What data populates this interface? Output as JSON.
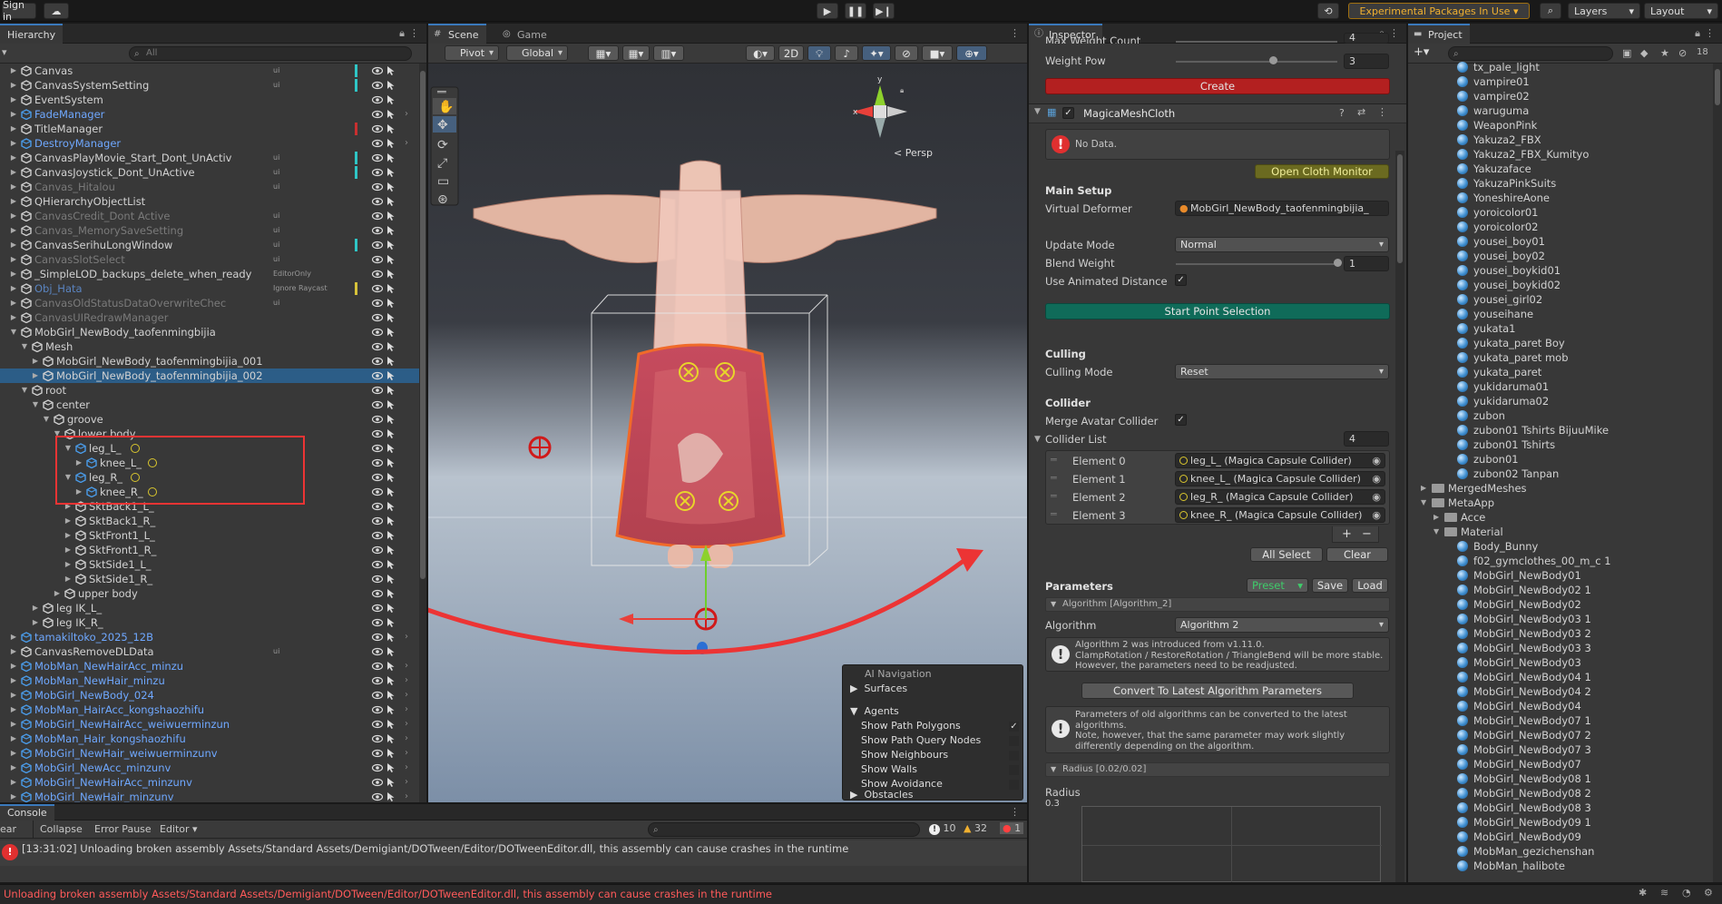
{
  "topbar": {
    "sign_in": "Sign in",
    "experimental": "Experimental Packages In Use",
    "layers": "Layers",
    "layout": "Layout"
  },
  "hierarchy": {
    "tab": "Hierarchy",
    "search_placeholder": "All",
    "rows": [
      {
        "name": "Canvas",
        "indent": 0,
        "color": "#d2d2d2",
        "tag": "ui",
        "bar": "#2fc6c6"
      },
      {
        "name": "CanvasSystemSetting",
        "indent": 0,
        "color": "#d2d2d2",
        "tag": "ui",
        "bar": "#2fc6c6"
      },
      {
        "name": "EventSystem",
        "indent": 0,
        "color": "#d2d2d2",
        "tag": "",
        "bar": ""
      },
      {
        "name": "FadeManager",
        "indent": 0,
        "color": "#6fa8ff",
        "tag": "",
        "bar": "",
        "prefab": true
      },
      {
        "name": "TitleManager",
        "indent": 0,
        "color": "#d2d2d2",
        "tag": "",
        "bar": "#c83030"
      },
      {
        "name": "DestroyManager",
        "indent": 0,
        "color": "#6fa8ff",
        "tag": "",
        "bar": "",
        "prefab": true
      },
      {
        "name": "CanvasPlayMovie_Start_Dont_UnActiv",
        "indent": 0,
        "color": "#d2d2d2",
        "tag": "ui",
        "bar": "#2fc6c6"
      },
      {
        "name": "CanvasJoystick_Dont_UnActive",
        "indent": 0,
        "color": "#d2d2d2",
        "tag": "ui",
        "bar": "#2fc6c6"
      },
      {
        "name": "Canvas_Hitalou",
        "indent": 0,
        "color": "#7a7a7a",
        "tag": "ui",
        "bar": ""
      },
      {
        "name": "QHierarchyObjectList",
        "indent": 0,
        "color": "#d2d2d2",
        "tag": "",
        "bar": ""
      },
      {
        "name": "CanvasCredit_Dont Active",
        "indent": 0,
        "color": "#7a7a7a",
        "tag": "ui",
        "bar": ""
      },
      {
        "name": "Canvas_MemorySaveSetting",
        "indent": 0,
        "color": "#7a7a7a",
        "tag": "ui",
        "bar": ""
      },
      {
        "name": "CanvasSerihuLongWindow",
        "indent": 0,
        "color": "#d2d2d2",
        "tag": "ui",
        "bar": "#2fc6c6"
      },
      {
        "name": "CanvasSlotSelect",
        "indent": 0,
        "color": "#7a7a7a",
        "tag": "ui",
        "bar": ""
      },
      {
        "name": "_SimpleLOD_backups_delete_when_ready",
        "indent": 0,
        "color": "#d2d2d2",
        "tag": "EditorOnly",
        "bar": ""
      },
      {
        "name": "Obj_Hata",
        "indent": 0,
        "color": "#5a84c0",
        "tag": "Ignore Raycast",
        "bar": "#d6c23a"
      },
      {
        "name": "CanvasOldStatusDataOverwriteChec",
        "indent": 0,
        "color": "#7a7a7a",
        "tag": "ui",
        "bar": ""
      },
      {
        "name": "CanvasUIRedrawManager",
        "indent": 0,
        "color": "#7a7a7a",
        "tag": "",
        "bar": ""
      },
      {
        "name": "MobGirl_NewBody_taofenmingbijia",
        "indent": 0,
        "color": "#d2d2d2",
        "tag": "",
        "bar": "",
        "open": true
      },
      {
        "name": "Mesh",
        "indent": 1,
        "color": "#d2d2d2",
        "tag": "",
        "bar": "",
        "open": true
      },
      {
        "name": "MobGirl_NewBody_taofenmingbijia_001",
        "indent": 2,
        "color": "#d2d2d2",
        "tag": "",
        "bar": ""
      },
      {
        "name": "MobGirl_NewBody_taofenmingbijia_002",
        "indent": 2,
        "color": "#d2d2d2",
        "tag": "",
        "bar": "",
        "selected": true
      },
      {
        "name": "root",
        "indent": 1,
        "color": "#d2d2d2",
        "tag": "",
        "bar": "",
        "open": true
      },
      {
        "name": "center",
        "indent": 2,
        "color": "#d2d2d2",
        "tag": "",
        "bar": "",
        "open": true
      },
      {
        "name": "groove",
        "indent": 3,
        "color": "#d2d2d2",
        "tag": "",
        "bar": "",
        "open": true
      },
      {
        "name": "lower body",
        "indent": 4,
        "color": "#d2d2d2",
        "tag": "",
        "bar": "",
        "open": true
      },
      {
        "name": "leg_L_",
        "indent": 5,
        "color": "#d2d2d2",
        "tag": "",
        "bar": "",
        "open": true,
        "blue": true
      },
      {
        "name": "knee_L_",
        "indent": 6,
        "color": "#d2d2d2",
        "tag": "",
        "bar": "",
        "blue": true
      },
      {
        "name": "leg_R_",
        "indent": 5,
        "color": "#d2d2d2",
        "tag": "",
        "bar": "",
        "open": true,
        "blue": true
      },
      {
        "name": "knee_R_",
        "indent": 6,
        "color": "#d2d2d2",
        "tag": "",
        "bar": "",
        "blue": true
      },
      {
        "name": "SktBack1_L_",
        "indent": 5,
        "color": "#d2d2d2",
        "tag": "",
        "bar": ""
      },
      {
        "name": "SktBack1_R_",
        "indent": 5,
        "color": "#d2d2d2",
        "tag": "",
        "bar": ""
      },
      {
        "name": "SktFront1_L_",
        "indent": 5,
        "color": "#d2d2d2",
        "tag": "",
        "bar": ""
      },
      {
        "name": "SktFront1_R_",
        "indent": 5,
        "color": "#d2d2d2",
        "tag": "",
        "bar": ""
      },
      {
        "name": "SktSide1_L_",
        "indent": 5,
        "color": "#d2d2d2",
        "tag": "",
        "bar": ""
      },
      {
        "name": "SktSide1_R_",
        "indent": 5,
        "color": "#d2d2d2",
        "tag": "",
        "bar": ""
      },
      {
        "name": "upper body",
        "indent": 4,
        "color": "#d2d2d2",
        "tag": "",
        "bar": ""
      },
      {
        "name": "leg IK_L_",
        "indent": 2,
        "color": "#d2d2d2",
        "tag": "",
        "bar": ""
      },
      {
        "name": "leg IK_R_",
        "indent": 2,
        "color": "#d2d2d2",
        "tag": "",
        "bar": ""
      },
      {
        "name": "tamakiltoko_2025_12B",
        "indent": 0,
        "color": "#6fa8ff",
        "tag": "",
        "bar": "",
        "prefab": true
      },
      {
        "name": "CanvasRemoveDLData",
        "indent": 0,
        "color": "#d2d2d2",
        "tag": "ui",
        "bar": ""
      },
      {
        "name": "MobMan_NewHairAcc_minzu",
        "indent": 0,
        "color": "#6fa8ff",
        "tag": "",
        "bar": "",
        "prefab": true
      },
      {
        "name": "MobMan_NewHair_minzu",
        "indent": 0,
        "color": "#6fa8ff",
        "tag": "",
        "bar": "",
        "prefab": true
      },
      {
        "name": "MobGirl_NewBody_024",
        "indent": 0,
        "color": "#6fa8ff",
        "tag": "",
        "bar": "",
        "prefab": true
      },
      {
        "name": "MobMan_HairAcc_kongshaozhifu",
        "indent": 0,
        "color": "#6fa8ff",
        "tag": "",
        "bar": "",
        "prefab": true
      },
      {
        "name": "MobGirl_NewHairAcc_weiwuerminzun",
        "indent": 0,
        "color": "#6fa8ff",
        "tag": "",
        "bar": "",
        "prefab": true
      },
      {
        "name": "MobMan_Hair_kongshaozhifu",
        "indent": 0,
        "color": "#6fa8ff",
        "tag": "",
        "bar": "",
        "prefab": true
      },
      {
        "name": "MobGirl_NewHair_weiwuerminzunv",
        "indent": 0,
        "color": "#6fa8ff",
        "tag": "",
        "bar": "",
        "prefab": true
      },
      {
        "name": "MobGirl_NewAcc_minzunv",
        "indent": 0,
        "color": "#6fa8ff",
        "tag": "",
        "bar": "",
        "prefab": true
      },
      {
        "name": "MobGirl_NewHairAcc_minzunv",
        "indent": 0,
        "color": "#6fa8ff",
        "tag": "",
        "bar": "",
        "prefab": true
      },
      {
        "name": "MobGirl_NewHair_minzunv",
        "indent": 0,
        "color": "#6fa8ff",
        "tag": "",
        "bar": "",
        "prefab": true
      }
    ]
  },
  "scene": {
    "tab_scene": "Scene",
    "tab_game": "Game",
    "pivot": "Pivot",
    "global": "Global",
    "mode2d": "2D",
    "persp": "Persp",
    "nav_overlay": {
      "title": "AI Navigation",
      "surfaces": "Surfaces",
      "agents": "Agents",
      "items": [
        "Show Path Polygons",
        "Show Path Query Nodes",
        "Show Neighbours",
        "Show Walls",
        "Show Avoidance"
      ],
      "obstacles": "Obstacles"
    }
  },
  "inspector": {
    "tab": "Inspector",
    "max_weight_count_label": "Max Weight Count",
    "max_weight_count_value": "4",
    "weight_pow_label": "Weight Pow",
    "weight_pow_value": "3",
    "weight_pow_level": 0.6,
    "create_button": "Create",
    "component_title": "MagicaMeshCloth",
    "no_data": "No Data.",
    "open_cloth_monitor": "Open Cloth Monitor",
    "main_setup": "Main Setup",
    "virtual_deformer_label": "Virtual Deformer",
    "virtual_deformer_value": "MobGirl_NewBody_taofenmingbijia_",
    "update_mode_label": "Update Mode",
    "update_mode_value": "Normal",
    "blend_weight_label": "Blend Weight",
    "blend_weight_value": "1",
    "blend_weight_level": 1.0,
    "use_animated_distance_label": "Use Animated Distance",
    "start_point_selection": "Start Point Selection",
    "culling": "Culling",
    "culling_mode_label": "Culling Mode",
    "culling_mode_value": "Reset",
    "collider": "Collider",
    "merge_avatar_collider_label": "Merge Avatar Collider",
    "collider_list_label": "Collider List",
    "collider_list_count": "4",
    "elements": [
      {
        "label": "Element 0",
        "value": "leg_L_ (Magica Capsule Collider)"
      },
      {
        "label": "Element 1",
        "value": "knee_L_ (Magica Capsule Collider)"
      },
      {
        "label": "Element 2",
        "value": "leg_R_ (Magica Capsule Collider)"
      },
      {
        "label": "Element 3",
        "value": "knee_R_ (Magica Capsule Collider)"
      }
    ],
    "plus": "+",
    "minus": "−",
    "all_select": "All Select",
    "clear": "Clear",
    "parameters": "Parameters",
    "preset": "Preset",
    "save": "Save",
    "load": "Load",
    "algorithm_header": "Algorithm [Algorithm_2]",
    "algorithm_label": "Algorithm",
    "algorithm_value": "Algorithm 2",
    "algorithm_help": "Algorithm 2 was introduced from v1.11.0.\nClampRotation / RestoreRotation / TriangleBend will be more stable.\nHowever, the parameters need to be readjusted.",
    "convert_button": "Convert To Latest Algorithm Parameters",
    "convert_help": "Parameters of old algorithms can be converted to the latest algorithms.\nNote, however, that the same parameter may work slightly differently depending on the algorithm.",
    "radius_header": "Radius [0.02/0.02]",
    "radius_label": "Radius",
    "radius_value": "0.3"
  },
  "project": {
    "tab": "Project",
    "items": [
      {
        "name": "tx_pale_light",
        "type": "ball",
        "indent": 2
      },
      {
        "name": "vampire01",
        "type": "ball",
        "indent": 2
      },
      {
        "name": "vampire02",
        "type": "ball",
        "indent": 2
      },
      {
        "name": "waruguma",
        "type": "ball",
        "indent": 2
      },
      {
        "name": "WeaponPink",
        "type": "ball",
        "indent": 2
      },
      {
        "name": "Yakuza2_FBX",
        "type": "ball",
        "indent": 2
      },
      {
        "name": "Yakuza2_FBX_Kumityo",
        "type": "ball",
        "indent": 2
      },
      {
        "name": "Yakuzaface",
        "type": "ball",
        "indent": 2
      },
      {
        "name": "YakuzaPinkSuits",
        "type": "ball",
        "indent": 2
      },
      {
        "name": "YoneshireAone",
        "type": "ball",
        "indent": 2
      },
      {
        "name": "yoroicolor01",
        "type": "ball",
        "indent": 2
      },
      {
        "name": "yoroicolor02",
        "type": "ball",
        "indent": 2
      },
      {
        "name": "yousei_boy01",
        "type": "ball",
        "indent": 2
      },
      {
        "name": "yousei_boy02",
        "type": "ball",
        "indent": 2
      },
      {
        "name": "yousei_boykid01",
        "type": "ball",
        "indent": 2
      },
      {
        "name": "yousei_boykid02",
        "type": "ball",
        "indent": 2
      },
      {
        "name": "yousei_girl02",
        "type": "ball",
        "indent": 2
      },
      {
        "name": "youseihane",
        "type": "ball",
        "indent": 2
      },
      {
        "name": "yukata1",
        "type": "ball",
        "indent": 2
      },
      {
        "name": "yukata_paret Boy",
        "type": "ball",
        "indent": 2
      },
      {
        "name": "yukata_paret mob",
        "type": "ball",
        "indent": 2
      },
      {
        "name": "yukata_paret",
        "type": "ball",
        "indent": 2
      },
      {
        "name": "yukidaruma01",
        "type": "ball",
        "indent": 2
      },
      {
        "name": "yukidaruma02",
        "type": "ball",
        "indent": 2
      },
      {
        "name": "zubon",
        "type": "ball",
        "indent": 2
      },
      {
        "name": "zubon01 Tshirts BijuuMike",
        "type": "ball",
        "indent": 2
      },
      {
        "name": "zubon01 Tshirts",
        "type": "ball",
        "indent": 2
      },
      {
        "name": "zubon01",
        "type": "ball",
        "indent": 2
      },
      {
        "name": "zubon02 Tanpan",
        "type": "ball",
        "indent": 2
      },
      {
        "name": "MergedMeshes",
        "type": "folder",
        "indent": 0,
        "arrow": "▶"
      },
      {
        "name": "MetaApp",
        "type": "folder",
        "indent": 0,
        "arrow": "▼"
      },
      {
        "name": "Acce",
        "type": "folder",
        "indent": 1,
        "arrow": "▶"
      },
      {
        "name": "Material",
        "type": "folder",
        "indent": 1,
        "arrow": "▼"
      },
      {
        "name": "Body_Bunny",
        "type": "ball",
        "indent": 2
      },
      {
        "name": "f02_gymclothes_00_m_c 1",
        "type": "ball",
        "indent": 2
      },
      {
        "name": "MobGirl_NewBody01",
        "type": "ball",
        "indent": 2
      },
      {
        "name": "MobGirl_NewBody02 1",
        "type": "ball",
        "indent": 2
      },
      {
        "name": "MobGirl_NewBody02",
        "type": "ball",
        "indent": 2
      },
      {
        "name": "MobGirl_NewBody03 1",
        "type": "ball",
        "indent": 2
      },
      {
        "name": "MobGirl_NewBody03 2",
        "type": "ball",
        "indent": 2
      },
      {
        "name": "MobGirl_NewBody03 3",
        "type": "ball",
        "indent": 2
      },
      {
        "name": "MobGirl_NewBody03",
        "type": "ball",
        "indent": 2
      },
      {
        "name": "MobGirl_NewBody04 1",
        "type": "ball",
        "indent": 2
      },
      {
        "name": "MobGirl_NewBody04 2",
        "type": "ball",
        "indent": 2
      },
      {
        "name": "MobGirl_NewBody04",
        "type": "ball",
        "indent": 2
      },
      {
        "name": "MobGirl_NewBody07 1",
        "type": "ball",
        "indent": 2
      },
      {
        "name": "MobGirl_NewBody07 2",
        "type": "ball",
        "indent": 2
      },
      {
        "name": "MobGirl_NewBody07 3",
        "type": "ball",
        "indent": 2
      },
      {
        "name": "MobGirl_NewBody07",
        "type": "ball",
        "indent": 2
      },
      {
        "name": "MobGirl_NewBody08 1",
        "type": "ball",
        "indent": 2
      },
      {
        "name": "MobGirl_NewBody08 2",
        "type": "ball",
        "indent": 2
      },
      {
        "name": "MobGirl_NewBody08 3",
        "type": "ball",
        "indent": 2
      },
      {
        "name": "MobGirl_NewBody09 1",
        "type": "ball",
        "indent": 2
      },
      {
        "name": "MobGirl_NewBody09",
        "type": "ball",
        "indent": 2
      },
      {
        "name": "MobMan_gezichenshan",
        "type": "ball",
        "indent": 2
      },
      {
        "name": "MobMan_halibote",
        "type": "ball",
        "indent": 2
      }
    ]
  },
  "console": {
    "tab": "Console",
    "clear": "ear",
    "collapse": "Collapse",
    "error_pause": "Error Pause",
    "editor": "Editor",
    "count_info": "10",
    "count_warn": "32",
    "count_error": "1",
    "message": "[13:31:02] Unloading broken assembly Assets/Standard Assets/Demigiant/DOTween/Editor/DOTweenEditor.dll, this assembly can cause crashes in the runtime",
    "status": "Unloading broken assembly Assets/Standard Assets/Demigiant/DOTween/Editor/DOTweenEditor.dll, this assembly can cause crashes in the runtime"
  },
  "colors": {
    "accent": "#3a79bb",
    "annotation_red": "#ec3434",
    "create_red": "#b32020",
    "start_green": "#0f6b59",
    "preset_green": "#3fcc6a",
    "status_red": "#ff5a5a"
  }
}
